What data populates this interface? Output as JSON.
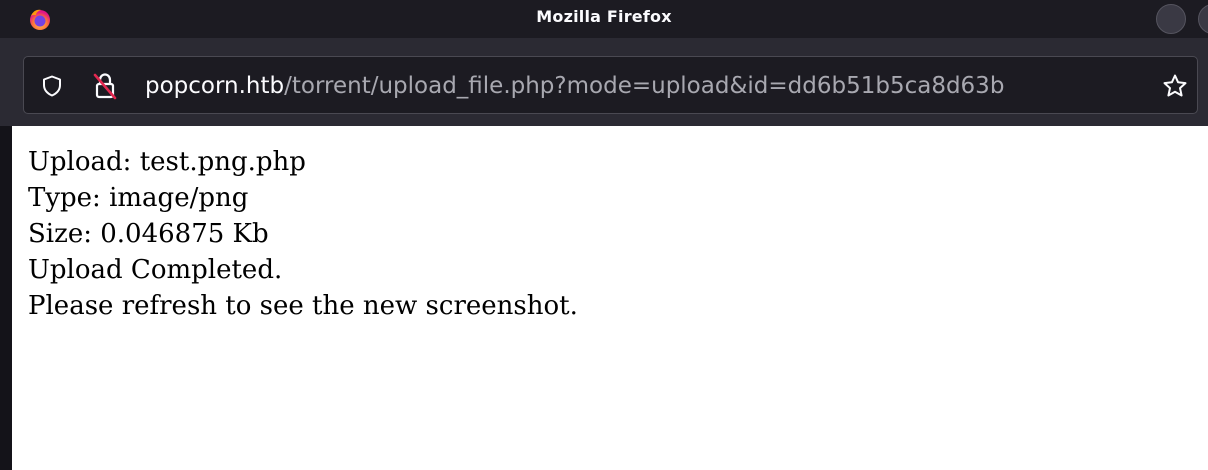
{
  "window": {
    "title": "Mozilla Firefox"
  },
  "icons": {
    "logo": "firefox-icon",
    "tracking_protection": "shield-icon",
    "connection": "insecure-lock-icon",
    "bookmark": "star-icon"
  },
  "urlbar": {
    "host": "popcorn.htb",
    "path": "/torrent/upload_file.php?mode=upload&id=dd6b51b5ca8d63b"
  },
  "page": {
    "lines": [
      "Upload: test.png.php",
      "Type: image/png",
      "Size: 0.046875 Kb",
      "Upload Completed.",
      "Please refresh to see the new screenshot."
    ]
  },
  "colors": {
    "chrome_bg": "#1c1b22",
    "toolbar_bg": "#2b2a33",
    "page_bg": "#ffffff",
    "text_primary": "#fbfbfe",
    "text_secondary": "#a8a8b0",
    "insecure_red": "#e22850"
  }
}
